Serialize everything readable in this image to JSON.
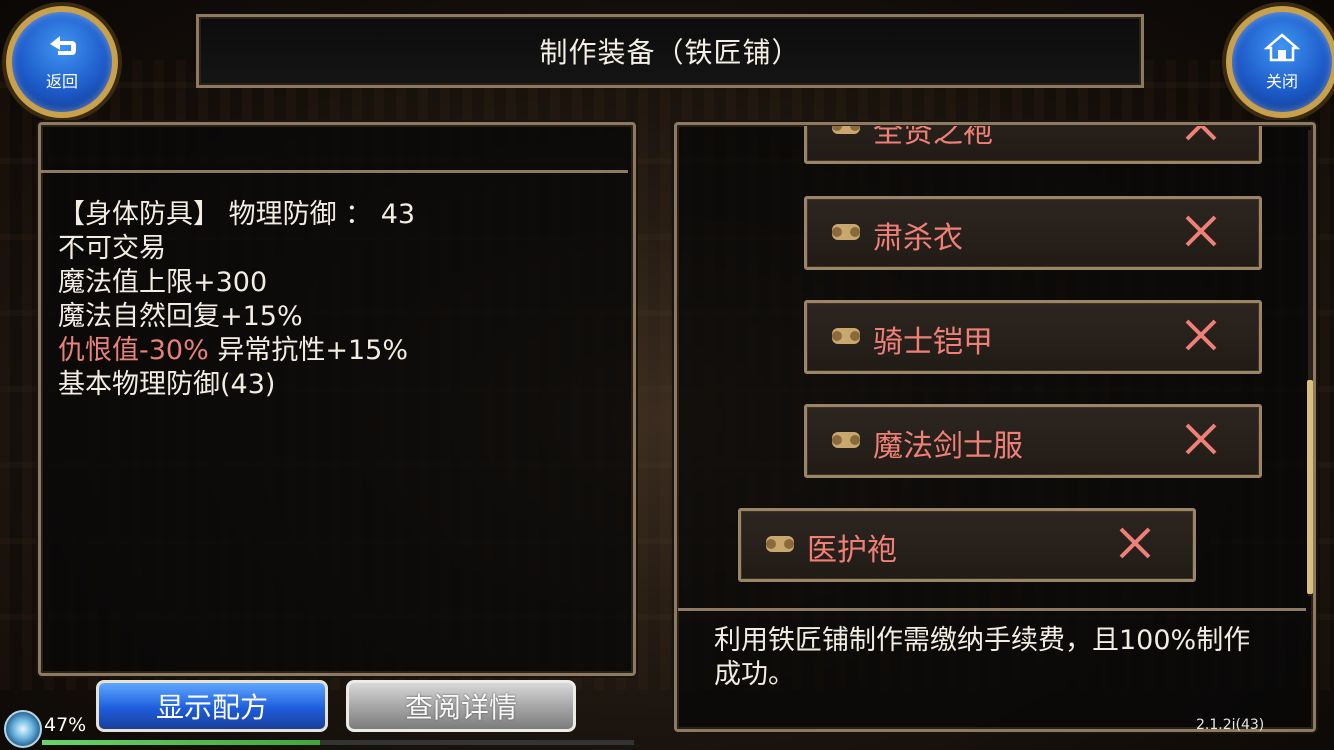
{
  "header": {
    "title": "制作装备（铁匠铺）"
  },
  "back_button": {
    "label": "返回",
    "icon": "back-arrow-icon"
  },
  "close_button": {
    "label": "关闭",
    "icon": "home-icon"
  },
  "item_stats": {
    "line1": "【身体防具】 物理防御 ：  43",
    "line2": "不可交易",
    "line3": "魔法值上限+300",
    "line4": "魔法自然回复+15%",
    "line5_red": "仇恨值-30%",
    "line5_rest": " 异常抗性+15%",
    "line6": "基本物理防御(43)"
  },
  "recipe_list": {
    "items": [
      {
        "name": "全贤之袍"
      },
      {
        "name": "肃杀衣"
      },
      {
        "name": "骑士铠甲"
      },
      {
        "name": "魔法剑士服"
      },
      {
        "name": "医护袍"
      }
    ]
  },
  "description": "利用铁匠铺制作需缴纳手续费，且100%制作成功。",
  "buttons": {
    "show_recipe": "显示配方",
    "view_details": "查阅详情"
  },
  "status": {
    "percent": "47%",
    "progress": 0.47,
    "version": "2.1.2i(43)"
  },
  "colors": {
    "accent_red": "#f07f78",
    "frame": "#8d7a63",
    "blue_button": "#1d5ddc"
  }
}
